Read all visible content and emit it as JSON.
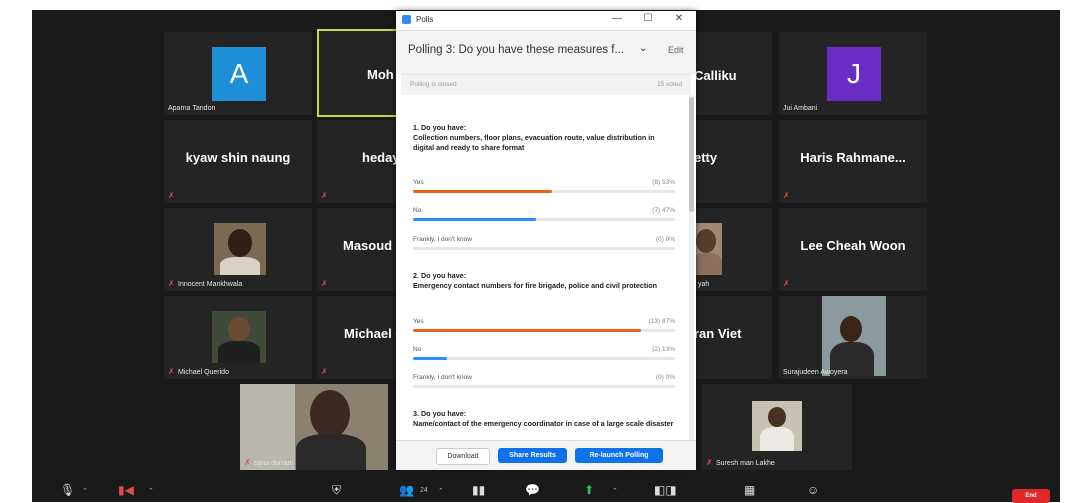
{
  "poll_window": {
    "title": "Polls",
    "minimize": "—",
    "maximize": "☐",
    "close": "✕",
    "question_selector": "Polling 3: Do you have these measures f...",
    "chevron": "⌄",
    "edit_label": "Edit",
    "status_left": "Polling is closed",
    "status_right": "15 voted",
    "questions": [
      {
        "title": "1. Do you have:\nCollection numbers, floor plans, evacuation route, value distribution in digital and ready to share format",
        "options": [
          {
            "label": "Yes",
            "result": "(8) 53%",
            "percent": 53,
            "color": "#e8631a"
          },
          {
            "label": "No",
            "result": "(7) 47%",
            "percent": 47,
            "color": "#2d8cff"
          },
          {
            "label": "Frankly, I don't know",
            "result": "(0) 0%",
            "percent": 0,
            "color": "#2d8cff"
          }
        ]
      },
      {
        "title": "2. Do you have:\nEmergency contact numbers for fire brigade, police and civil protection",
        "options": [
          {
            "label": "Yes",
            "result": "(13) 87%",
            "percent": 87,
            "color": "#e8631a"
          },
          {
            "label": "No",
            "result": "(2) 13%",
            "percent": 13,
            "color": "#2d8cff"
          },
          {
            "label": "Frankly, I don't know",
            "result": "(0) 0%",
            "percent": 0,
            "color": "#2d8cff"
          }
        ]
      },
      {
        "title": "3. Do you have:\nName/contact  of the emergency coordinator  in case of a large scale disaster",
        "options": []
      }
    ],
    "download_label": "Download",
    "share_label": "Share Results",
    "relaunch_label": "Re-launch Polling"
  },
  "participants": {
    "aparna": {
      "initial": "A",
      "name": "Aparna Tandon",
      "color": "#1e8fd6"
    },
    "moh": {
      "name": "Moh"
    },
    "calliku": {
      "name": "Calliku"
    },
    "jui": {
      "initial": "J",
      "name": "Jui Ambani",
      "color": "#6b2cc4"
    },
    "kyaw": {
      "name": "kyaw shin naung"
    },
    "heday": {
      "name": "heday"
    },
    "etty": {
      "name": "etty"
    },
    "haris": {
      "name": "Haris  Rahmane..."
    },
    "innocent": {
      "name": "Innocent Mankhwala"
    },
    "masoud": {
      "name": "Masoud"
    },
    "yah": {
      "name": "yah"
    },
    "lee": {
      "name": "Lee Cheah Woon"
    },
    "michael_q": {
      "name": "Michael Querido"
    },
    "michael": {
      "name": "Michael C"
    },
    "ran_viet": {
      "name": "ran Viet"
    },
    "surajudeen": {
      "name": "Surajudeen Awoyera"
    },
    "sana": {
      "name": "sana durrani"
    },
    "suresh": {
      "name": "Suresh man Lakhe"
    }
  },
  "toolbar": {
    "participants_count": "24",
    "end_label": "End"
  }
}
